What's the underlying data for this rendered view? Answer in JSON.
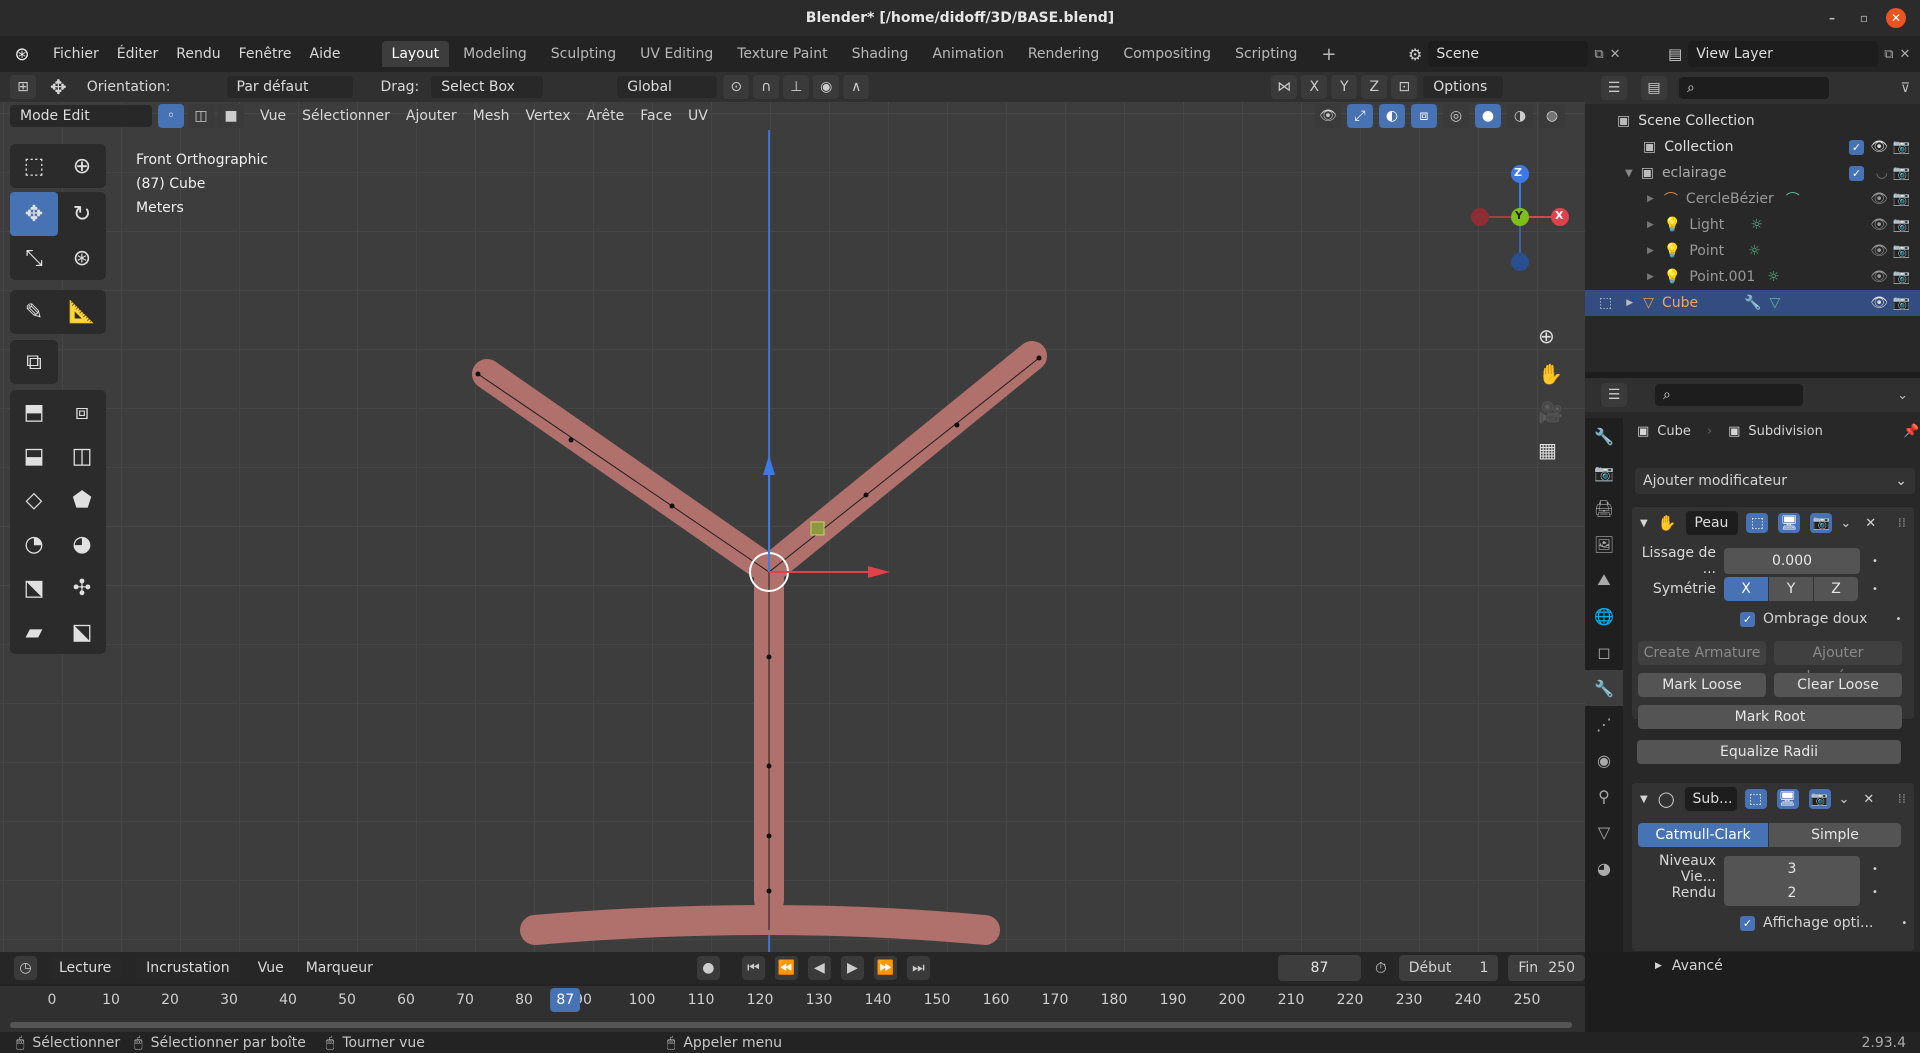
{
  "window": {
    "title": "Blender* [/home/didoff/3D/BASE.blend]"
  },
  "menu": {
    "items": [
      "Fichier",
      "Éditer",
      "Rendu",
      "Fenêtre",
      "Aide"
    ]
  },
  "workspaces": [
    "Layout",
    "Modeling",
    "Sculpting",
    "UV Editing",
    "Texture Paint",
    "Shading",
    "Animation",
    "Rendering",
    "Compositing",
    "Scripting"
  ],
  "scene": {
    "name": "Scene",
    "view_layer": "View Layer"
  },
  "tool_header": {
    "orientation_label": "Orientation:",
    "orientation_value": "Par défaut",
    "drag_label": "Drag:",
    "drag_value": "Select Box",
    "transform_space": "Global",
    "axis_x": "X",
    "axis_y": "Y",
    "axis_z": "Z",
    "options": "Options"
  },
  "viewport_header": {
    "mode": "Mode Edit",
    "menus": [
      "Vue",
      "Sélectionner",
      "Ajouter",
      "Mesh",
      "Vertex",
      "Arête",
      "Face",
      "UV"
    ]
  },
  "overlay_info": {
    "line1": "Front Orthographic",
    "line2": "(87) Cube",
    "line3": "Meters"
  },
  "gizmo": {
    "z": "Z",
    "y": "Y",
    "x": "X"
  },
  "outliner": {
    "items": [
      {
        "label": "Scene Collection"
      },
      {
        "label": "Collection"
      },
      {
        "label": "eclairage"
      },
      {
        "label": "CercleBézier"
      },
      {
        "label": "Light"
      },
      {
        "label": "Point"
      },
      {
        "label": "Point.001"
      },
      {
        "label": "Cube"
      }
    ]
  },
  "properties": {
    "object": "Cube",
    "modifier_ctx": "Subdivision",
    "add_modifier": "Ajouter modificateur",
    "skin": {
      "name": "Peau",
      "smooth_label": "Lissage de ...",
      "smooth_value": "0.000",
      "symmetry_label": "Symétrie",
      "sym_x": "X",
      "sym_y": "Y",
      "sym_z": "Z",
      "smooth_shading": "Ombrage doux",
      "create_armature": "Create Armature",
      "add_data": "Ajouter données...",
      "mark_loose": "Mark Loose",
      "clear_loose": "Clear Loose",
      "mark_root": "Mark Root",
      "equalize": "Equalize Radii"
    },
    "subsurf": {
      "name": "Sub...",
      "catmull": "Catmull-Clark",
      "simple": "Simple",
      "levels_label": "Niveaux Vie...",
      "levels_value": "3",
      "render_label": "Rendu",
      "render_value": "2",
      "optimal": "Affichage opti...",
      "advanced": "Avancé"
    }
  },
  "timeline": {
    "playback": "Lecture",
    "keying": "Incrustation",
    "view": "Vue",
    "marker": "Marqueur",
    "current_frame": "87",
    "start_label": "Début",
    "start": "1",
    "end_label": "Fin",
    "end": "250",
    "ticks": [
      "0",
      "10",
      "20",
      "30",
      "40",
      "50",
      "60",
      "70",
      "80",
      "90",
      "100",
      "110",
      "120",
      "130",
      "140",
      "150",
      "160",
      "170",
      "180",
      "190",
      "200",
      "210",
      "220",
      "230",
      "240",
      "250"
    ],
    "playhead": "87"
  },
  "status": {
    "select": "Sélectionner",
    "box_select": "Sélectionner par boîte",
    "rotate_view": "Tourner vue",
    "call_menu": "Appeler menu",
    "version": "2.93.4"
  },
  "colors": {
    "accent": "#4772b3",
    "mesh": "#b0706c",
    "selection_bg": "#334d80",
    "close": "#e95420"
  }
}
